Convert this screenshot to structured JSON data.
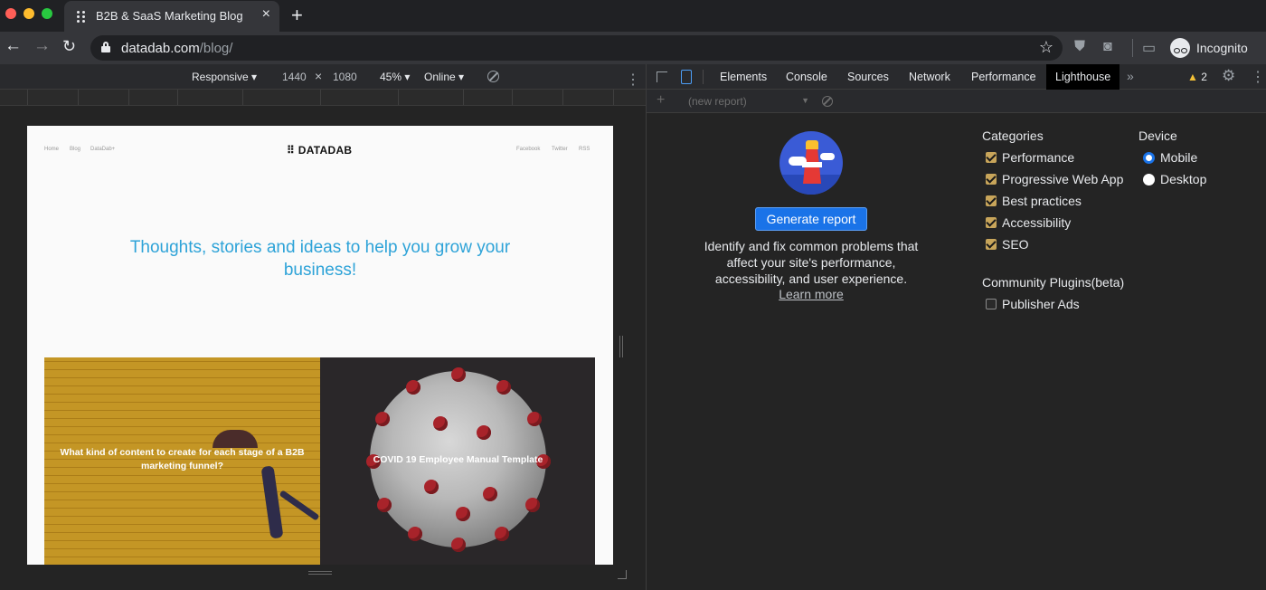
{
  "browser": {
    "tab_title": "B2B & SaaS Marketing Blog",
    "new_tab_symbol": "+",
    "close_symbol": "×",
    "url_host": "datadab.com",
    "url_path": "/blog/",
    "profile_label": "Incognito"
  },
  "device_toolbar": {
    "mode": "Responsive ▾",
    "width": "1440",
    "times": "×",
    "height": "1080",
    "zoom": "45% ▾",
    "network": "Online ▾"
  },
  "site": {
    "nav_left": [
      "Home",
      "Blog",
      "DataDab+"
    ],
    "logo": "DATADAB",
    "nav_right": [
      "Facebook",
      "Twitter",
      "RSS"
    ],
    "hero": "Thoughts, stories and ideas to help you grow your business!",
    "cards": [
      {
        "title": "What kind of content to create for each stage of a B2B marketing funnel?"
      },
      {
        "title": "COVID 19 Employee Manual Template"
      }
    ]
  },
  "devtools": {
    "tabs": [
      "Elements",
      "Console",
      "Sources",
      "Network",
      "Performance",
      "Lighthouse"
    ],
    "active_tab": "Lighthouse",
    "more_tabs": "»",
    "warning_count": "2",
    "report_select": "(new report)",
    "lighthouse": {
      "generate_label": "Generate report",
      "description": "Identify and fix common problems that affect your site's performance, accessibility, and user experience.",
      "learn_more": "Learn more",
      "categories_title": "Categories",
      "categories": [
        {
          "label": "Performance",
          "checked": true
        },
        {
          "label": "Progressive Web App",
          "checked": true
        },
        {
          "label": "Best practices",
          "checked": true
        },
        {
          "label": "Accessibility",
          "checked": true
        },
        {
          "label": "SEO",
          "checked": true
        }
      ],
      "plugins_title": "Community Plugins(beta)",
      "plugins": [
        {
          "label": "Publisher Ads",
          "checked": false
        }
      ],
      "device_title": "Device",
      "devices": [
        {
          "label": "Mobile",
          "selected": true
        },
        {
          "label": "Desktop",
          "selected": false
        }
      ]
    }
  },
  "colors": {
    "accent_blue": "#1a73e8",
    "hero_text": "#2ea3d8",
    "checkbox_gold": "#c8a55a"
  }
}
